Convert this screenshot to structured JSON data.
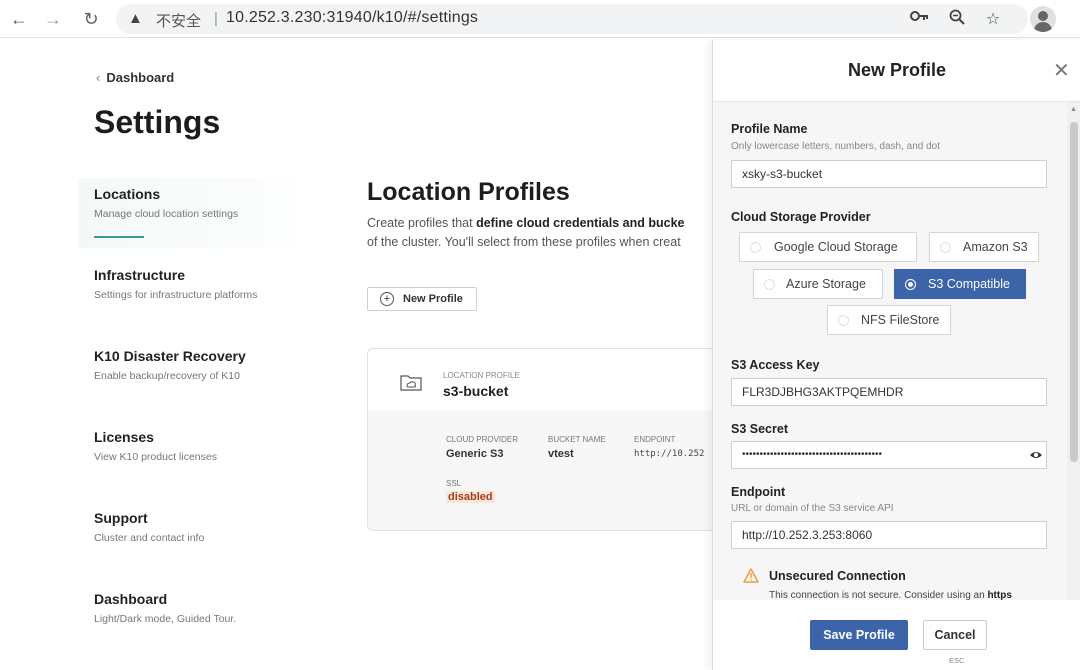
{
  "browser": {
    "insecure_label": "不安全",
    "separator": "|",
    "url": "10.252.3.230:31940/k10/#/settings"
  },
  "sidebar": {
    "back_label": "Dashboard",
    "page_title": "Settings",
    "items": [
      {
        "title": "Locations",
        "subtitle": "Manage cloud location settings"
      },
      {
        "title": "Infrastructure",
        "subtitle": "Settings for infrastructure platforms"
      },
      {
        "title": "K10 Disaster Recovery",
        "subtitle": "Enable backup/recovery of K10"
      },
      {
        "title": "Licenses",
        "subtitle": "View K10 product licenses"
      },
      {
        "title": "Support",
        "subtitle": "Cluster and contact info"
      },
      {
        "title": "Dashboard",
        "subtitle": "Light/Dark mode, Guided Tour."
      }
    ]
  },
  "main": {
    "section_title": "Location Profiles",
    "desc_part1": "Create profiles that ",
    "desc_bold": "define cloud credentials and bucke",
    "desc_line2": "of the cluster. You'll select from these profiles when creat",
    "new_profile_label": "New Profile",
    "card": {
      "label": "LOCATION PROFILE",
      "name": "s3-bucket",
      "provider_label": "CLOUD PROVIDER",
      "provider_value": "Generic S3",
      "bucket_label": "BUCKET NAME",
      "bucket_value": "vtest",
      "endpoint_label": "ENDPOINT",
      "endpoint_value": "http://10.252",
      "ssl_label": "SSL",
      "ssl_value": "disabled"
    }
  },
  "panel": {
    "title": "New Profile",
    "profile_name": {
      "label": "Profile Name",
      "help": "Only lowercase letters, numbers, dash, and dot",
      "value": "xsky-s3-bucket"
    },
    "provider": {
      "label": "Cloud Storage Provider",
      "options": [
        "Google Cloud Storage",
        "Amazon S3",
        "Azure Storage",
        "S3 Compatible",
        "NFS FileStore"
      ],
      "selected": "S3 Compatible"
    },
    "access_key": {
      "label": "S3 Access Key",
      "value": "FLR3DJBHG3AKTPQEMHDR"
    },
    "secret": {
      "label": "S3 Secret",
      "value": "••••••••••••••••••••••••••••••••••••••••"
    },
    "endpoint": {
      "label": "Endpoint",
      "help": "URL or domain of the S3 service API",
      "value": "http://10.252.3.253:8060"
    },
    "warning": {
      "title": "Unsecured Connection",
      "text_part1": "This connection is not secure. Consider using an ",
      "text_bold": "https"
    },
    "save_label": "Save Profile",
    "cancel_label": "Cancel",
    "esc_hint": "ESC"
  },
  "colors": {
    "accent": "#3c64a8",
    "teal_underline": "#3a9c8c",
    "warning": "#e8a23a"
  }
}
